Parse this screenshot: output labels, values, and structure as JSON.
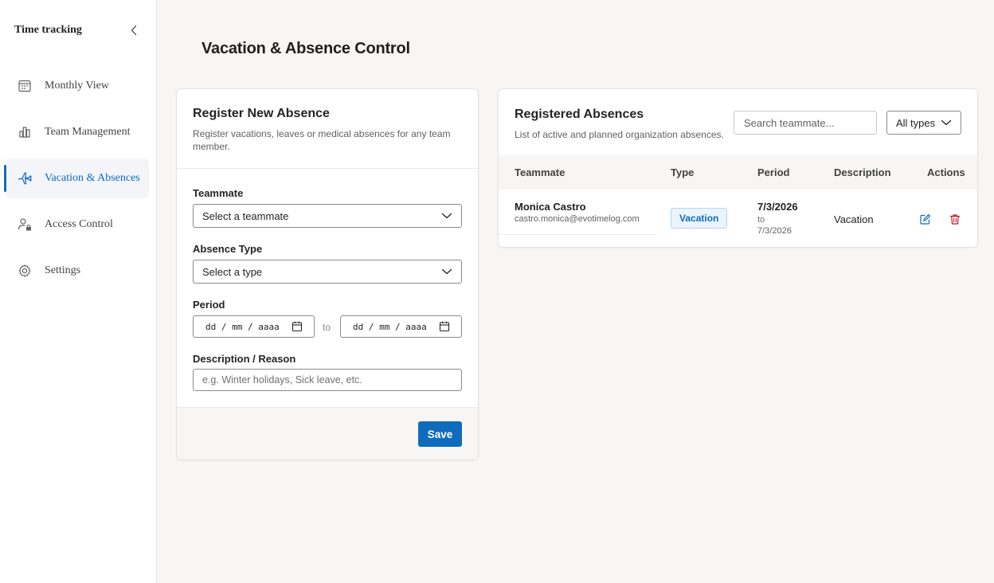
{
  "sidebar": {
    "title": "Time tracking",
    "items": [
      {
        "label": "Monthly View",
        "icon": "calendar-icon"
      },
      {
        "label": "Team Management",
        "icon": "chart-bar-icon"
      },
      {
        "label": "Vacation & Absences",
        "icon": "airplane-icon",
        "active": true
      },
      {
        "label": "Access Control",
        "icon": "people-lock-icon"
      },
      {
        "label": "Settings",
        "icon": "gear-icon"
      }
    ]
  },
  "page": {
    "title": "Vacation & Absence Control"
  },
  "register_form": {
    "title": "Register New Absence",
    "subtitle": "Register vacations, leaves or medical absences for any team member.",
    "teammate_label": "Teammate",
    "teammate_value": "Select a teammate",
    "type_label": "Absence Type",
    "type_value": "Select a type",
    "period_label": "Period",
    "date_from": "dd / mm / aaaa",
    "date_to": "dd / mm / aaaa",
    "to_text": "to",
    "description_label": "Description / Reason",
    "description_placeholder": "e.g. Winter holidays, Sick leave, etc.",
    "save_label": "Save"
  },
  "absences": {
    "title": "Registered Absences",
    "subtitle": "List of active and planned organization absences.",
    "search_placeholder": "Search teammate...",
    "filter_value": "All types",
    "columns": [
      "Teammate",
      "Type",
      "Period",
      "Description",
      "Actions"
    ],
    "rows": [
      {
        "name": "Monica Castro",
        "email": "castro.monica@evotimelog.com",
        "type": "Vacation",
        "from": "7/3/2026",
        "to_text": "to",
        "to": "7/3/2026",
        "description": "Vacation"
      }
    ]
  },
  "colors": {
    "accent": "#0f6cbd",
    "danger": "#c50f1f",
    "badge_bg": "#ebf3fc"
  }
}
